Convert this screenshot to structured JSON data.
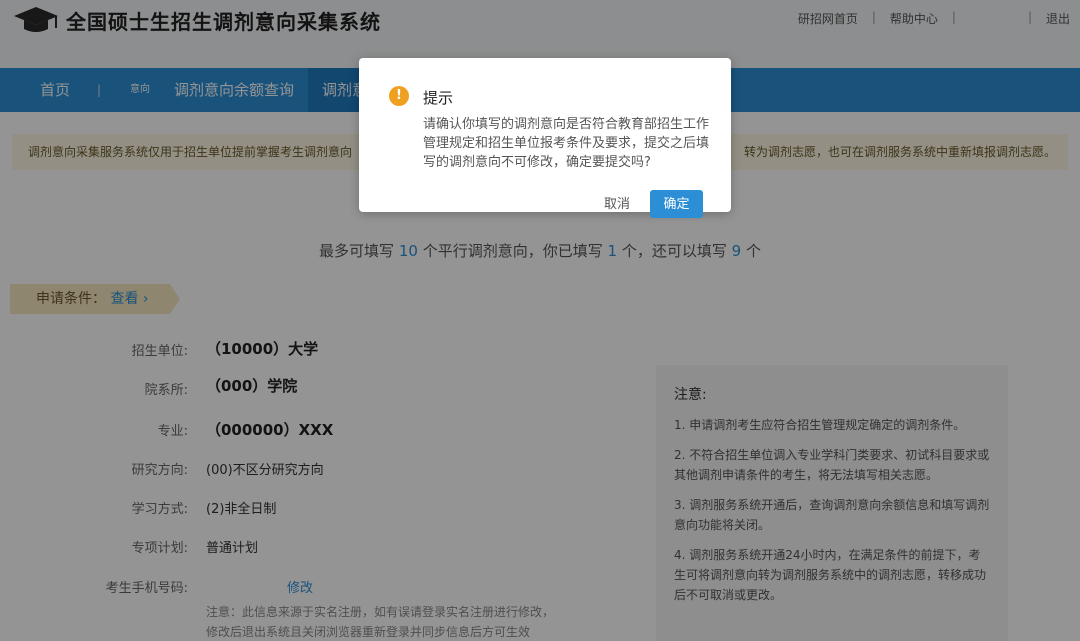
{
  "header": {
    "title": "全国硕士生招生调剂意向采集系统",
    "links": [
      "研招网首页",
      "帮助中心",
      "退出"
    ]
  },
  "nav": {
    "home": "首页",
    "small": "意向",
    "balance": "调剂意向余额查询",
    "active": "调剂意"
  },
  "notice": {
    "left": "调剂意向采集服务系统仅用于招生单位提前掌握考生调剂意向",
    "right": "转为调剂志愿，也可在调剂服务系统中重新填报调剂志愿。"
  },
  "count": {
    "prefix": "最多可填写",
    "max": "10",
    "mid1": "个平行调剂意向，你已填写",
    "filled": "1",
    "mid2": "个，还可以填写",
    "remaining": "9",
    "suffix": "个"
  },
  "apply": {
    "label": "申请条件：",
    "view": "查看",
    "arrow": "›"
  },
  "form": {
    "unit_label": "招生单位:",
    "unit_value": "（10000）大学",
    "dept_label": "院系所:",
    "dept_value": "（000）学院",
    "major_label": "专业:",
    "major_value": "（000000）XXX",
    "direction_label": "研究方向:",
    "direction_value": "(00)不区分研究方向",
    "mode_label": "学习方式:",
    "mode_value": "(2)非全日制",
    "plan_label": "专项计划:",
    "plan_value": "普通计划",
    "phone_label": "考生手机号码:",
    "phone_edit": "修改",
    "phone_note1": "注意：此信息来源于实名注册，如有误请登录实名注册进行修改，",
    "phone_note2": "修改后退出系统且关闭浏览器重新登录并同步信息后方可生效"
  },
  "side": {
    "title": "注意:",
    "items": [
      "1. 申请调剂考生应符合招生管理规定确定的调剂条件。",
      "2. 不符合招生单位调入专业学科门类要求、初试科目要求或其他调剂申请条件的考生，将无法填写相关志愿。",
      "3. 调剂服务系统开通后，查询调剂意向余额信息和填写调剂意向功能将关闭。",
      "4. 调剂服务系统开通24小时内，在满足条件的前提下，考生可将调剂意向转为调剂服务系统中的调剂志愿，转移成功后不可取消或更改。"
    ]
  },
  "dialog": {
    "icon": "!",
    "title": "提示",
    "message": "请确认你填写的调剂意向是否符合教育部招生工作管理规定和招生单位报考条件及要求，提交之后填写的调剂意向不可修改，确定要提交吗?",
    "cancel": "取消",
    "confirm": "确定"
  },
  "colors": {
    "accent": "#2c8fd6",
    "warning": "#f0a020"
  }
}
